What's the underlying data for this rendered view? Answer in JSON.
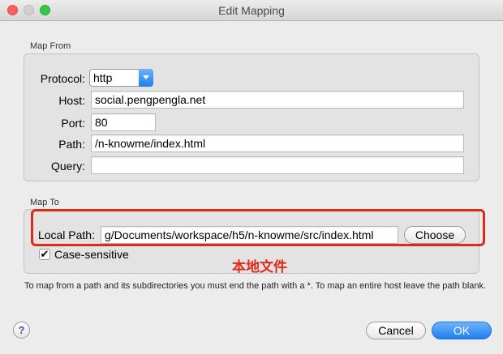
{
  "window": {
    "title": "Edit Mapping"
  },
  "map_from": {
    "group_label": "Map From",
    "protocol": {
      "label": "Protocol:",
      "value": "http"
    },
    "host": {
      "label": "Host:",
      "value": "social.pengpengla.net"
    },
    "port": {
      "label": "Port:",
      "value": "80"
    },
    "path": {
      "label": "Path:",
      "value": "/n-knowme/index.html"
    },
    "query": {
      "label": "Query:",
      "value": ""
    }
  },
  "map_to": {
    "group_label": "Map To",
    "local_path": {
      "label": "Local Path:",
      "value": "g/Documents/workspace/h5/n-knowme/src/index.html"
    },
    "choose_label": "Choose",
    "case_sensitive": {
      "label": "Case-sensitive",
      "checked": true
    }
  },
  "annotation": "本地文件",
  "help_text": "To map from a path and its subdirectories you must end the path with a *. To map an entire host leave the path blank.",
  "buttons": {
    "help": "?",
    "cancel": "Cancel",
    "ok": "OK"
  },
  "colors": {
    "accent": "#1f7ef0",
    "highlight": "#e02a19"
  }
}
